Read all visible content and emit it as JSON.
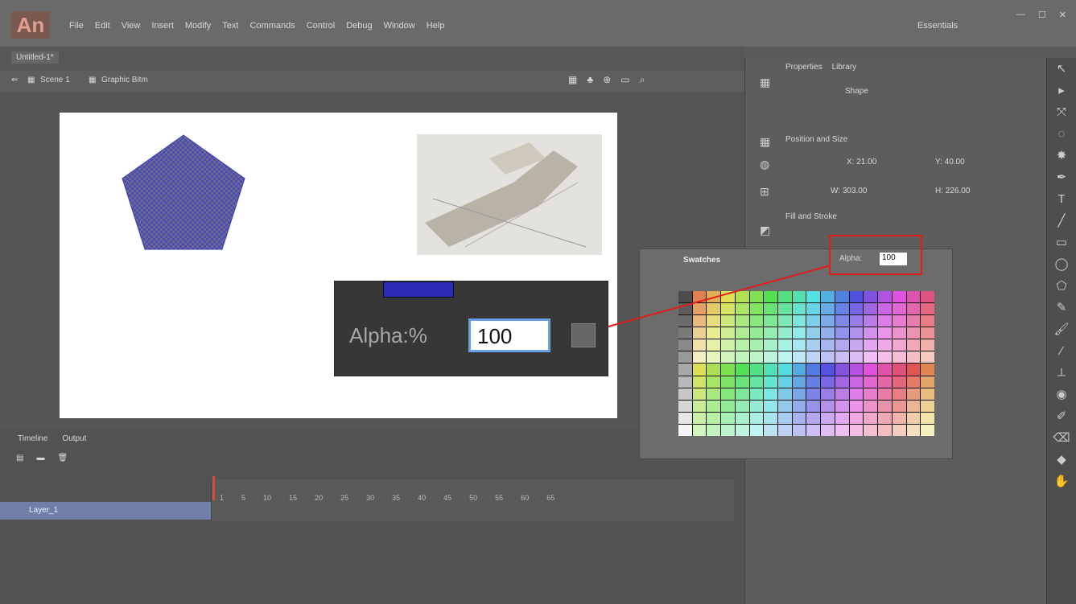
{
  "app": {
    "logo": "An",
    "menu": [
      "File",
      "Edit",
      "View",
      "Insert",
      "Modify",
      "Text",
      "Commands",
      "Control",
      "Debug",
      "Window",
      "Help"
    ],
    "workspace": "Essentials",
    "window_controls": [
      "—",
      "☐",
      "✕"
    ]
  },
  "document": {
    "tab": "Untitled-1*",
    "scene": "Scene 1",
    "symbol": "Graphic Bitm"
  },
  "zoom": {
    "alpha_label": "Alpha:%",
    "alpha_value": "100"
  },
  "swatch_popup": {
    "title": "Swatches",
    "alpha_label": "Alpha:",
    "alpha_value": "100"
  },
  "properties": {
    "tabs": [
      "Properties",
      "Library"
    ],
    "object_type": "Shape",
    "section_position": "Position and Size",
    "x": "X: 21.00",
    "y": "Y: 40.00",
    "w": "W: 303.00",
    "h": "H: 226.00",
    "section_fill": "Fill and Stroke"
  },
  "timeline": {
    "tabs": [
      "Timeline",
      "Output"
    ],
    "layer": "Layer_1",
    "frame_numbers": [
      "1",
      "5",
      "10",
      "15",
      "20",
      "25",
      "30",
      "35",
      "40",
      "45",
      "50",
      "55",
      "60",
      "65"
    ]
  },
  "colors": {
    "accent_red": "#e31b1b",
    "fill_blue": "#2c2cb8",
    "layer_highlight": "#6f7fa8"
  }
}
